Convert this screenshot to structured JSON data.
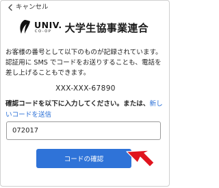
{
  "header": {
    "back_label": "キャンセル"
  },
  "logo": {
    "mark_word": "UNIV.",
    "mark_sub": "CO-OP",
    "org_name": "大学生協事業連合"
  },
  "message": {
    "line1": "お客様の番号として以下のものが記録されています。",
    "line2": "認証用に SMS でコードをお送りすることも、電話を",
    "line3": "差し上げることもできます。"
  },
  "phone_number": "XXX-XXX-67890",
  "prompt": {
    "text": "確認コードを以下に入力してください。または、",
    "resend_link": "新しいコードを送信"
  },
  "code_field": {
    "value": "072017"
  },
  "confirm_button": {
    "label": "コードの確認"
  },
  "colors": {
    "accent": "#2f73d8",
    "link": "#2a6fd6",
    "callout_arrow": "#e0141e"
  }
}
